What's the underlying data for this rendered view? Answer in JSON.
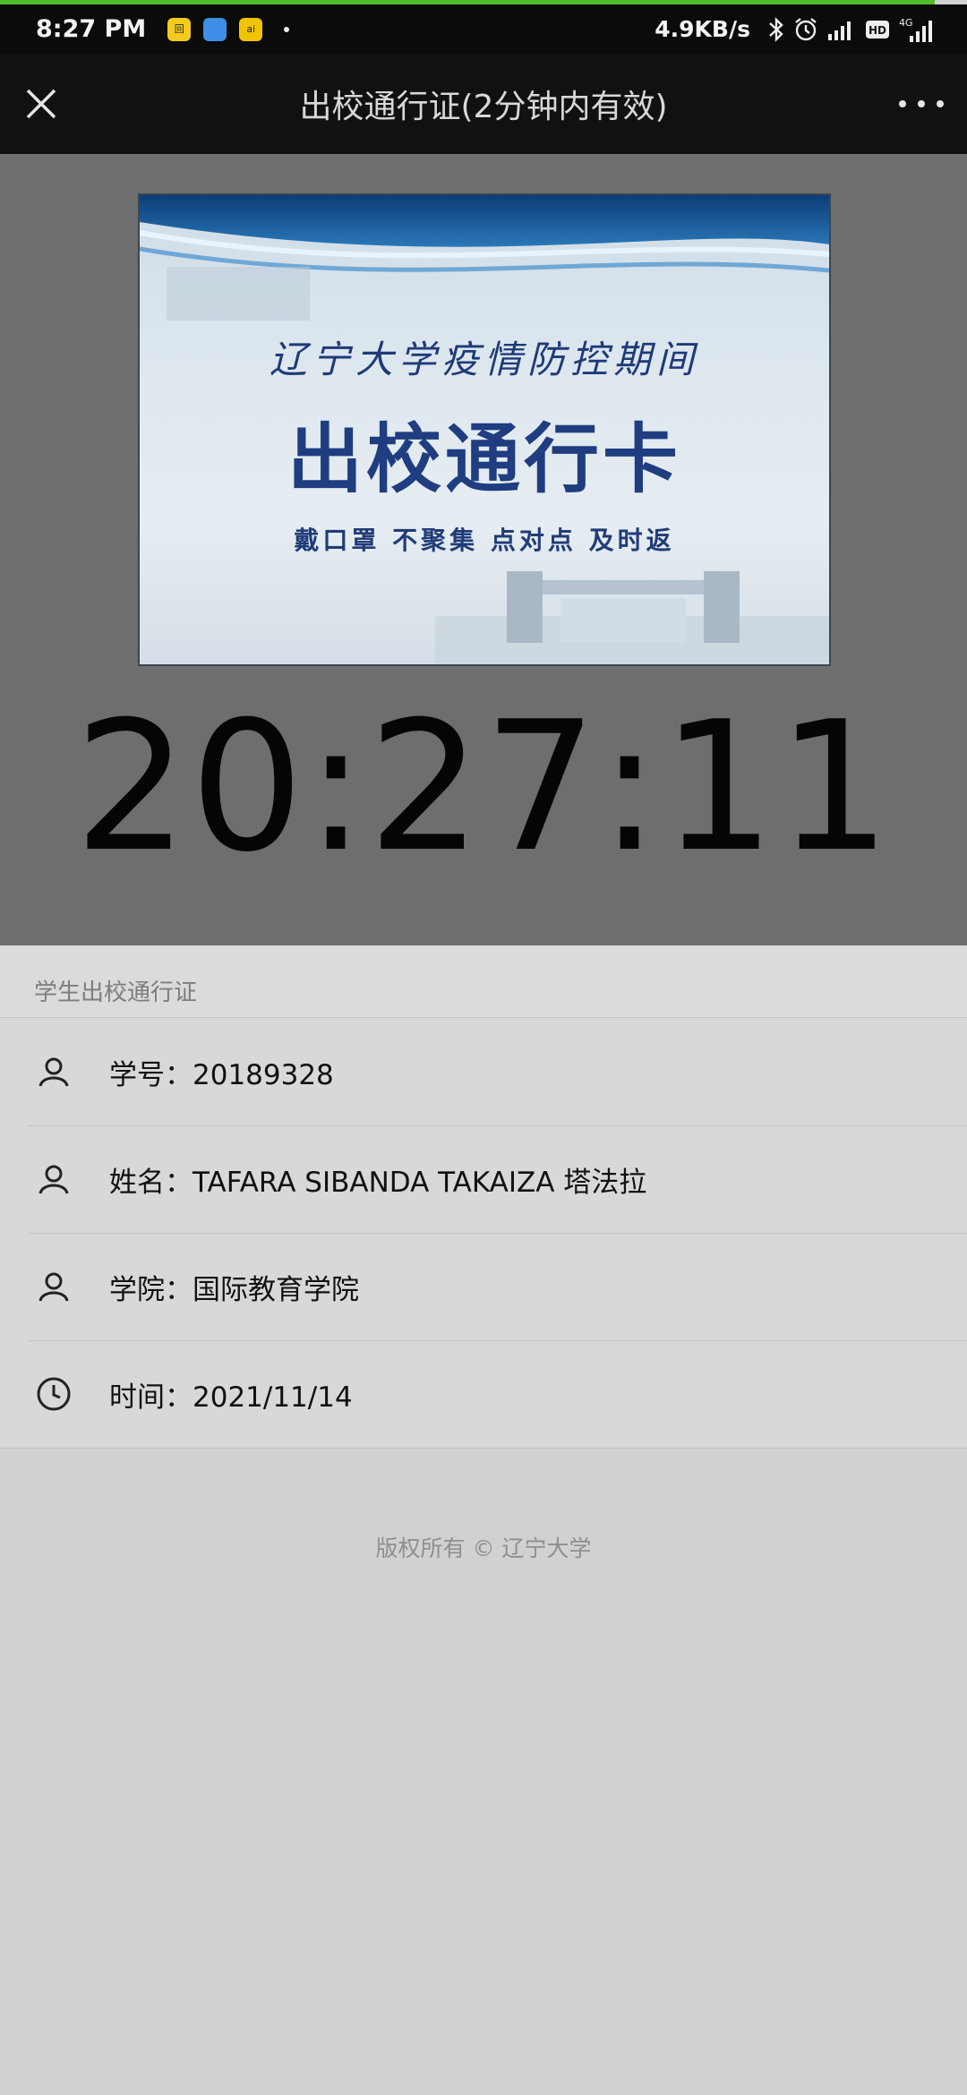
{
  "status_bar": {
    "time": "8:27 PM",
    "net_speed": "4.9KB/s",
    "app_icon_1": "回",
    "app_icon_3": "ai",
    "network_label": "4G",
    "hd_label": "HD"
  },
  "nav": {
    "title": "出校通行证(2分钟内有效)"
  },
  "banner": {
    "subtitle": "辽宁大学疫情防控期间",
    "title": "出校通行卡",
    "slogan": "戴口罩 不聚集 点对点 及时返"
  },
  "clock": "20:27:11",
  "section": {
    "header": "学生出校通行证"
  },
  "info": [
    {
      "icon": "person-icon",
      "text": "学号：20189328"
    },
    {
      "icon": "person-icon",
      "text": "姓名：TAFARA SIBANDA TAKAIZA 塔法拉"
    },
    {
      "icon": "person-icon",
      "text": "学院：国际教育学院"
    },
    {
      "icon": "clock-icon",
      "text": "时间：2021/11/14"
    }
  ],
  "footer": "版权所有 © 辽宁大学",
  "colors": {
    "progress": "#4fbd2a",
    "nav_bg": "#111111",
    "hero_bg": "#6e6e6e",
    "page_bg": "#d2d1d2",
    "banner_text": "#1f3d80"
  }
}
